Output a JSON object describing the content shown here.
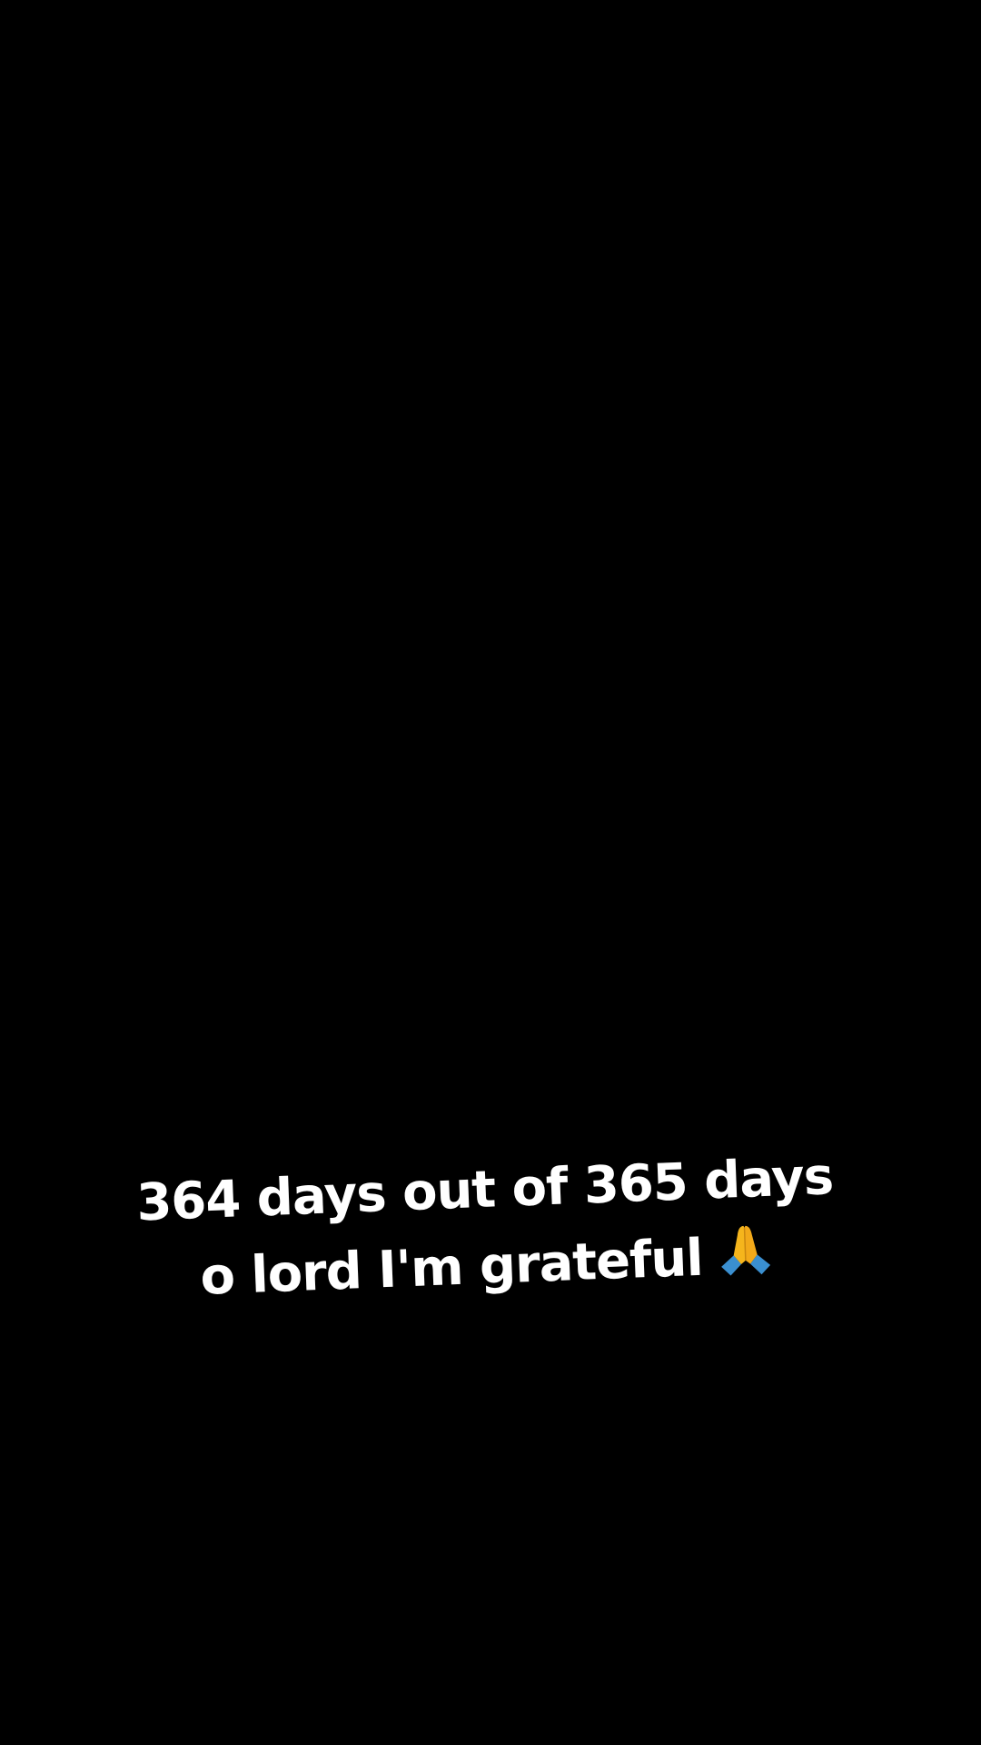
{
  "caption": {
    "line1": "364 days out of 365 days",
    "line2": "o lord I'm grateful",
    "emoji": "folded-hands-icon"
  },
  "colors": {
    "background": "#000000",
    "text": "#ffffff",
    "emoji_skin": "#f5b51c",
    "emoji_sleeve": "#3a8fd0"
  }
}
